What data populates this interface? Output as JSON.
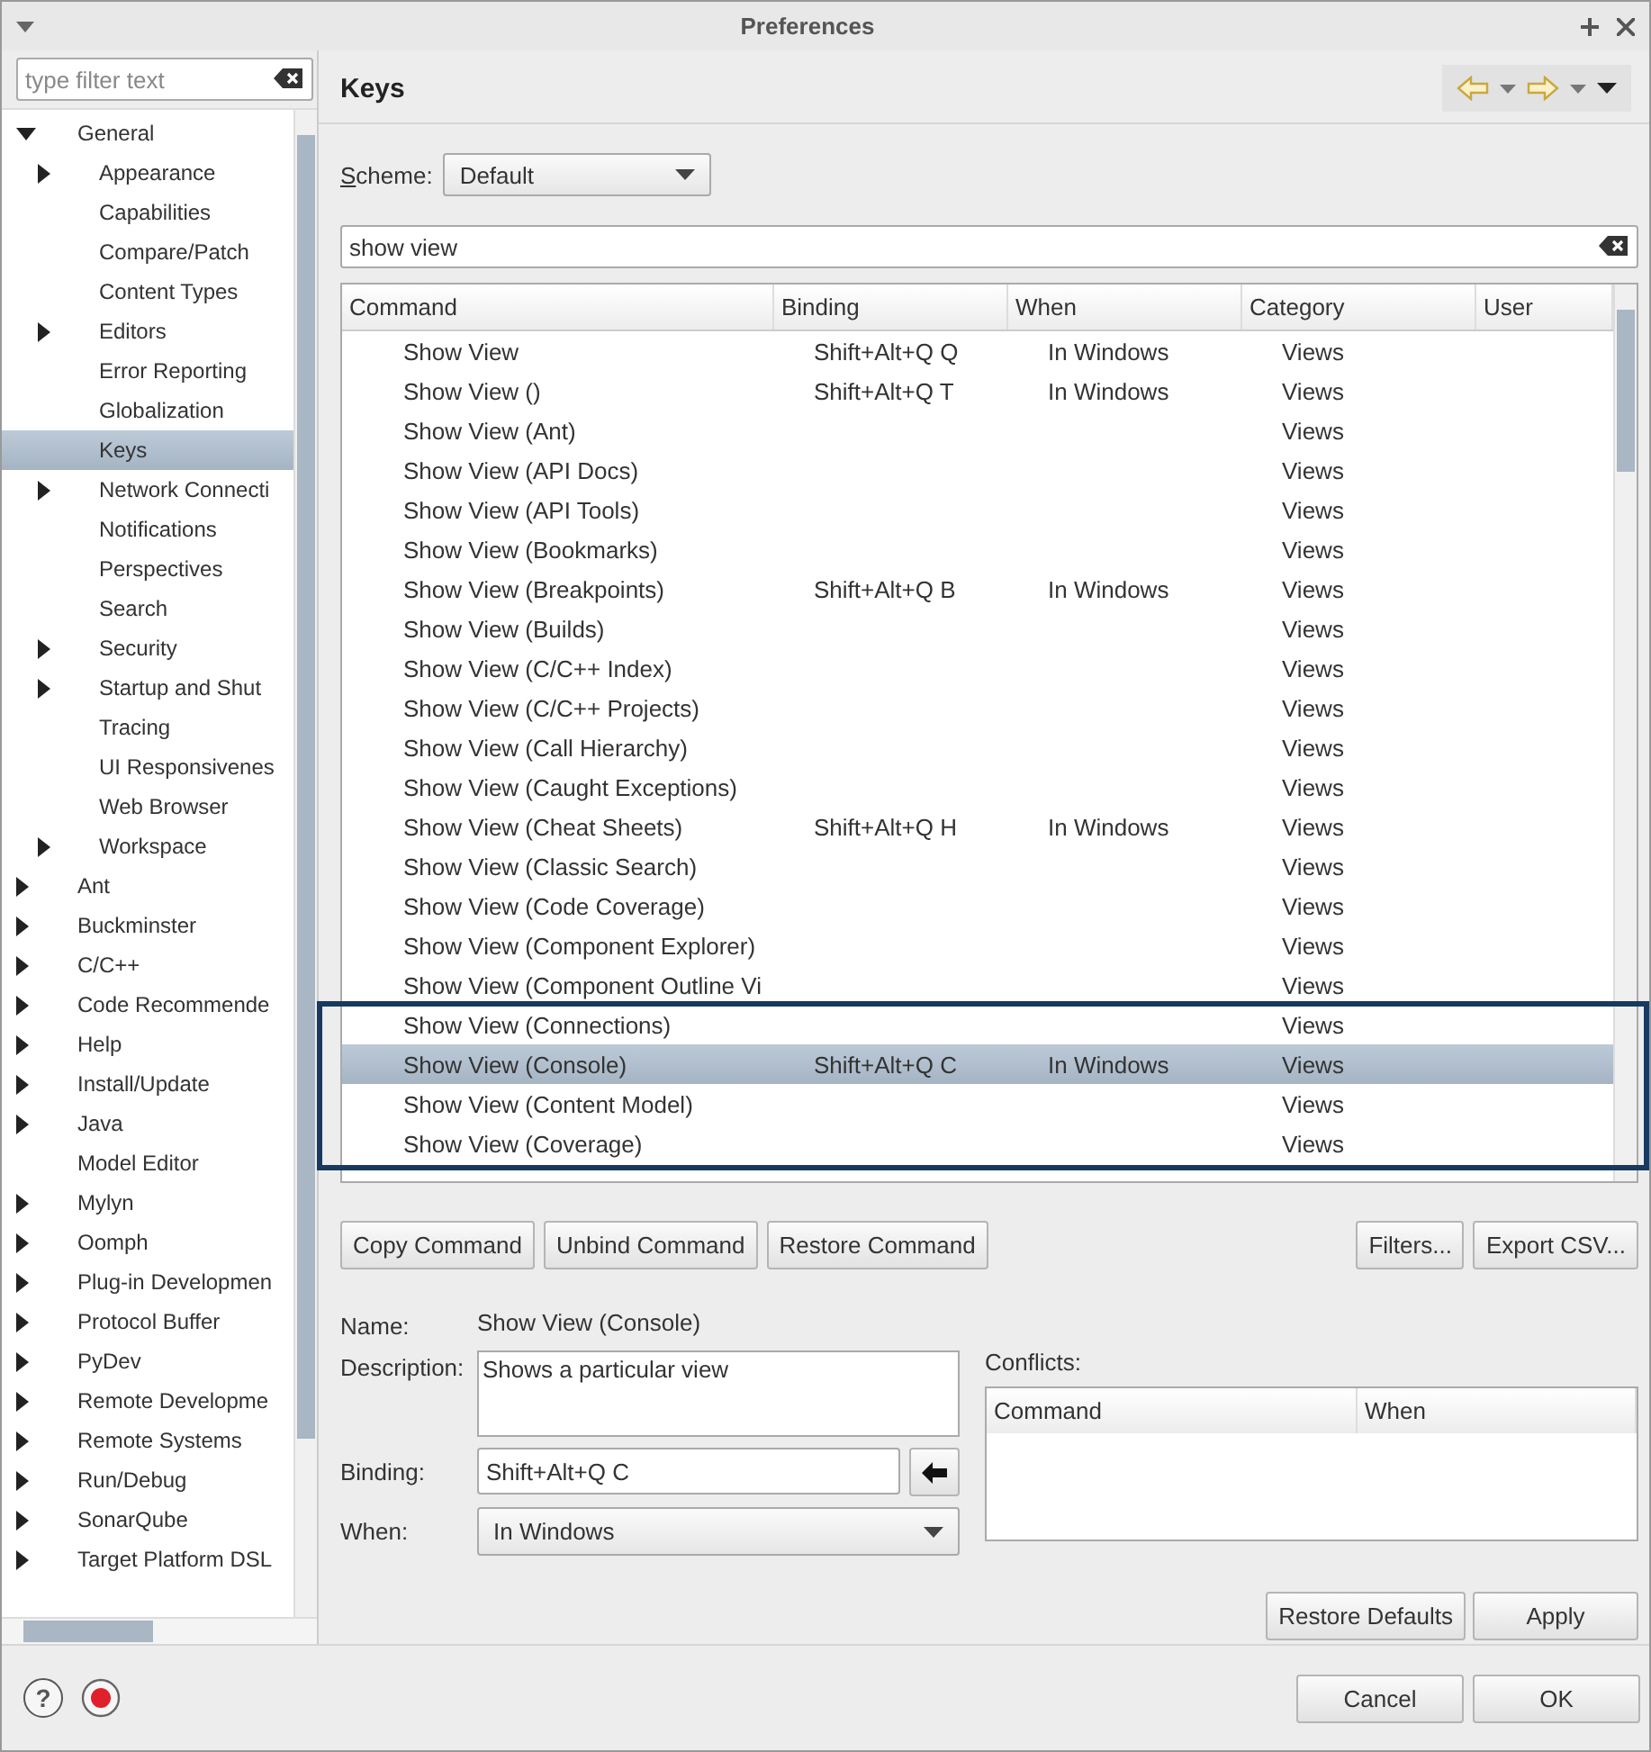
{
  "window": {
    "title": "Preferences"
  },
  "filter": {
    "placeholder": "type filter text"
  },
  "tree": [
    {
      "label": "General",
      "kind": "branch",
      "expanded": true,
      "selected": false,
      "children": [
        {
          "label": "Appearance",
          "kind": "branch",
          "expanded": false,
          "selected": false
        },
        {
          "label": "Capabilities",
          "kind": "leaf",
          "selected": false
        },
        {
          "label": "Compare/Patch",
          "kind": "leaf",
          "selected": false
        },
        {
          "label": "Content Types",
          "kind": "leaf",
          "selected": false
        },
        {
          "label": "Editors",
          "kind": "branch",
          "expanded": false,
          "selected": false
        },
        {
          "label": "Error Reporting",
          "kind": "leaf",
          "selected": false
        },
        {
          "label": "Globalization",
          "kind": "leaf",
          "selected": false
        },
        {
          "label": "Keys",
          "kind": "leaf",
          "selected": true
        },
        {
          "label": "Network Connecti",
          "kind": "branch",
          "expanded": false,
          "selected": false
        },
        {
          "label": "Notifications",
          "kind": "leaf",
          "selected": false
        },
        {
          "label": "Perspectives",
          "kind": "leaf",
          "selected": false
        },
        {
          "label": "Search",
          "kind": "leaf",
          "selected": false
        },
        {
          "label": "Security",
          "kind": "branch",
          "expanded": false,
          "selected": false
        },
        {
          "label": "Startup and Shut",
          "kind": "branch",
          "expanded": false,
          "selected": false
        },
        {
          "label": "Tracing",
          "kind": "leaf",
          "selected": false
        },
        {
          "label": "UI Responsivenes",
          "kind": "leaf",
          "selected": false
        },
        {
          "label": "Web Browser",
          "kind": "leaf",
          "selected": false
        },
        {
          "label": "Workspace",
          "kind": "branch",
          "expanded": false,
          "selected": false
        }
      ]
    },
    {
      "label": "Ant",
      "kind": "branch",
      "expanded": false,
      "selected": false
    },
    {
      "label": "Buckminster",
      "kind": "branch",
      "expanded": false,
      "selected": false
    },
    {
      "label": "C/C++",
      "kind": "branch",
      "expanded": false,
      "selected": false
    },
    {
      "label": "Code Recommende",
      "kind": "branch",
      "expanded": false,
      "selected": false
    },
    {
      "label": "Help",
      "kind": "branch",
      "expanded": false,
      "selected": false
    },
    {
      "label": "Install/Update",
      "kind": "branch",
      "expanded": false,
      "selected": false
    },
    {
      "label": "Java",
      "kind": "branch",
      "expanded": false,
      "selected": false
    },
    {
      "label": "Model Editor",
      "kind": "leaf",
      "selected": false
    },
    {
      "label": "Mylyn",
      "kind": "branch",
      "expanded": false,
      "selected": false
    },
    {
      "label": "Oomph",
      "kind": "branch",
      "expanded": false,
      "selected": false
    },
    {
      "label": "Plug-in Developmen",
      "kind": "branch",
      "expanded": false,
      "selected": false
    },
    {
      "label": "Protocol Buffer",
      "kind": "branch",
      "expanded": false,
      "selected": false
    },
    {
      "label": "PyDev",
      "kind": "branch",
      "expanded": false,
      "selected": false
    },
    {
      "label": "Remote Developme",
      "kind": "branch",
      "expanded": false,
      "selected": false
    },
    {
      "label": "Remote Systems",
      "kind": "branch",
      "expanded": false,
      "selected": false
    },
    {
      "label": "Run/Debug",
      "kind": "branch",
      "expanded": false,
      "selected": false
    },
    {
      "label": "SonarQube",
      "kind": "branch",
      "expanded": false,
      "selected": false
    },
    {
      "label": "Target Platform DSL",
      "kind": "branch",
      "expanded": false,
      "selected": false
    }
  ],
  "page": {
    "title": "Keys"
  },
  "scheme": {
    "label": "Scheme:",
    "value": "Default"
  },
  "search": {
    "value": "show view"
  },
  "table": {
    "columns": [
      "Command",
      "Binding",
      "When",
      "Category",
      "User"
    ],
    "rows": [
      {
        "command": "Show View",
        "binding": "Shift+Alt+Q Q",
        "when": "In Windows",
        "category": "Views",
        "selected": false,
        "highlighted": false
      },
      {
        "command": "Show View ()",
        "binding": "Shift+Alt+Q T",
        "when": "In Windows",
        "category": "Views",
        "selected": false,
        "highlighted": false
      },
      {
        "command": "Show View (Ant)",
        "category": "Views",
        "selected": false,
        "highlighted": false
      },
      {
        "command": "Show View (API Docs)",
        "category": "Views",
        "selected": false,
        "highlighted": false
      },
      {
        "command": "Show View (API Tools)",
        "category": "Views",
        "selected": false,
        "highlighted": false
      },
      {
        "command": "Show View (Bookmarks)",
        "category": "Views",
        "selected": false,
        "highlighted": false
      },
      {
        "command": "Show View (Breakpoints)",
        "binding": "Shift+Alt+Q B",
        "when": "In Windows",
        "category": "Views",
        "selected": false,
        "highlighted": false
      },
      {
        "command": "Show View (Builds)",
        "category": "Views",
        "selected": false,
        "highlighted": false
      },
      {
        "command": "Show View (C/C++ Index)",
        "category": "Views",
        "selected": false,
        "highlighted": false
      },
      {
        "command": "Show View (C/C++ Projects)",
        "category": "Views",
        "selected": false,
        "highlighted": false
      },
      {
        "command": "Show View (Call Hierarchy)",
        "category": "Views",
        "selected": false,
        "highlighted": false
      },
      {
        "command": "Show View (Caught Exceptions)",
        "category": "Views",
        "selected": false,
        "highlighted": false
      },
      {
        "command": "Show View (Cheat Sheets)",
        "binding": "Shift+Alt+Q H",
        "when": "In Windows",
        "category": "Views",
        "selected": false,
        "highlighted": false
      },
      {
        "command": "Show View (Classic Search)",
        "category": "Views",
        "selected": false,
        "highlighted": false
      },
      {
        "command": "Show View (Code Coverage)",
        "category": "Views",
        "selected": false,
        "highlighted": false
      },
      {
        "command": "Show View (Component Explorer)",
        "category": "Views",
        "selected": false,
        "highlighted": false
      },
      {
        "command": "Show View (Component Outline Vi",
        "category": "Views",
        "selected": false,
        "highlighted": false
      },
      {
        "command": "Show View (Connections)",
        "category": "Views",
        "selected": false,
        "highlighted": true
      },
      {
        "command": "Show View (Console)",
        "binding": "Shift+Alt+Q C",
        "when": "In Windows",
        "category": "Views",
        "selected": true,
        "highlighted": true
      },
      {
        "command": "Show View (Content Model)",
        "category": "Views",
        "selected": false,
        "highlighted": true
      },
      {
        "command": "Show View (Coverage)",
        "category": "Views",
        "selected": false,
        "highlighted": true
      }
    ]
  },
  "table_buttons": [
    "Copy Command",
    "Unbind Command",
    "Restore Command"
  ],
  "filter_buttons": [
    "Filters...",
    "Export CSV..."
  ],
  "details": {
    "name_label": "Name:",
    "name": "Show View (Console)",
    "description_label": "Description:",
    "description": "Shows a particular view",
    "binding_label": "Binding:",
    "binding": "Shift+Alt+Q C",
    "when_label": "When:",
    "when": "In Windows"
  },
  "conflicts": {
    "label": "Conflicts:",
    "columns": [
      "Command",
      "When"
    ]
  },
  "page_buttons": [
    "Restore Defaults",
    "Apply"
  ],
  "footer": {
    "help_glyph": "?"
  },
  "dialog_buttons": [
    "Cancel",
    "OK"
  ]
}
